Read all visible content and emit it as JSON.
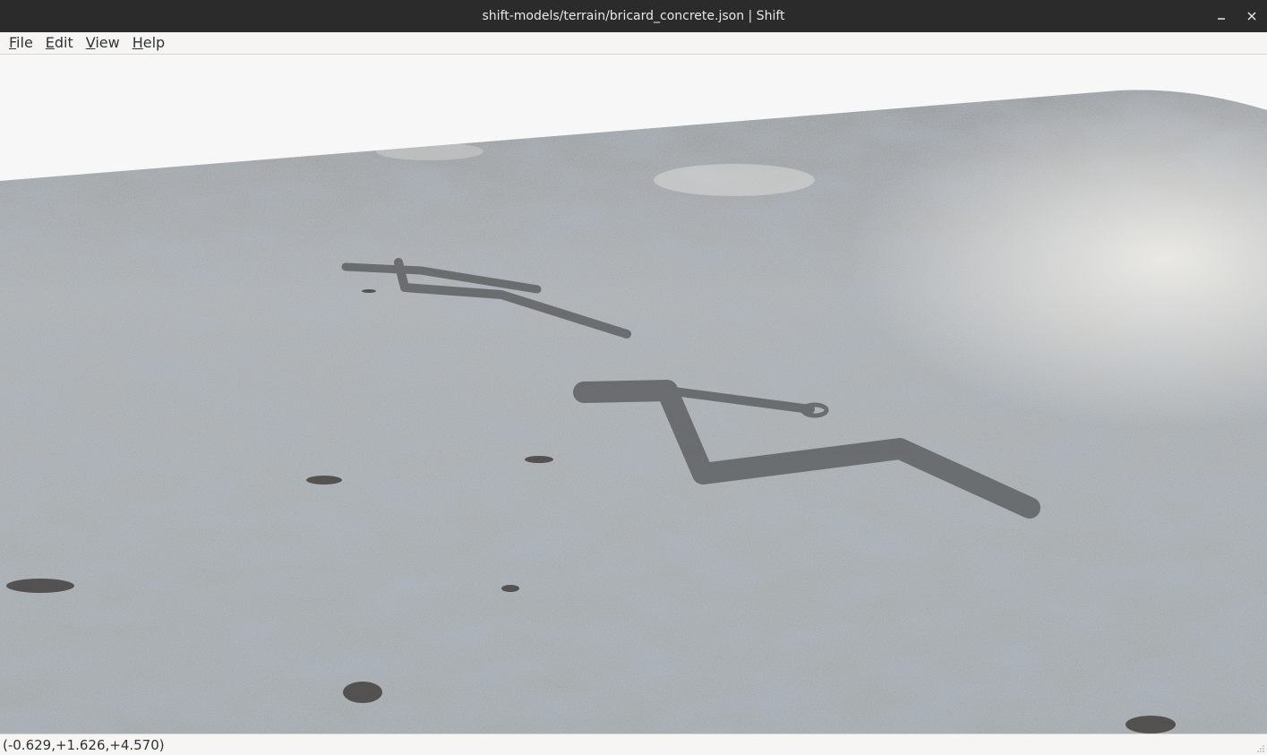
{
  "window": {
    "title": "shift-models/terrain/bricard_concrete.json | Shift",
    "minimize_icon": "minimize-icon",
    "close_icon": "close-icon"
  },
  "menubar": {
    "items": [
      {
        "label": "File"
      },
      {
        "label": "Edit"
      },
      {
        "label": "View"
      },
      {
        "label": "Help"
      }
    ]
  },
  "viewport": {
    "background_color": "#f7f7f7",
    "terrain_color": "#9ea3a6",
    "shadow_color": "#5a5c5e"
  },
  "statusbar": {
    "coordinates": "(-0.629,+1.626,+4.570)"
  }
}
